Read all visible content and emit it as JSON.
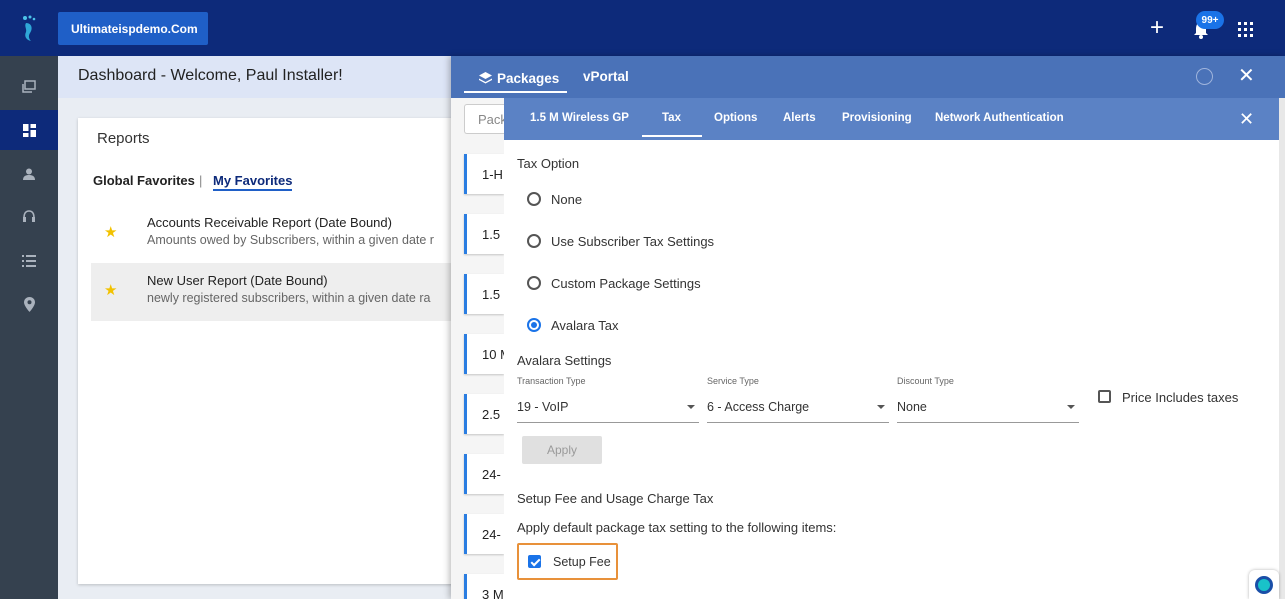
{
  "topbar": {
    "brand_label": "Ultimateispdemo.Com",
    "notification_badge": "99+",
    "icons": [
      "footprint-logo-icon",
      "plus-icon",
      "bell-icon",
      "apps-grid-icon"
    ]
  },
  "sidebar": {
    "items": [
      {
        "name": "sidebar-item-library",
        "icon": "library-icon",
        "active": false
      },
      {
        "name": "sidebar-item-dashboard",
        "icon": "dashboard-icon",
        "active": true
      },
      {
        "name": "sidebar-item-subscribers",
        "icon": "person-icon",
        "active": false
      },
      {
        "name": "sidebar-item-support",
        "icon": "headset-icon",
        "active": false
      },
      {
        "name": "sidebar-item-list",
        "icon": "list-icon",
        "active": false
      },
      {
        "name": "sidebar-item-map",
        "icon": "location-pin-icon",
        "active": false
      }
    ]
  },
  "dashboard": {
    "title": "Dashboard - Welcome, Paul Installer!",
    "reports_title": "Reports",
    "tabs": {
      "global": "Global Favorites",
      "separator": "|",
      "mine": "My Favorites"
    },
    "reports": [
      {
        "name": "Accounts Receivable Report (Date Bound)",
        "desc": "Amounts owed by Subscribers, within a given date r"
      },
      {
        "name": "New User Report (Date Bound)",
        "desc": "newly registered subscribers, within a given date ra"
      }
    ]
  },
  "packages_panel": {
    "tabs": [
      {
        "label": "Packages",
        "active": true
      },
      {
        "label": "vPortal",
        "active": false
      }
    ],
    "search_placeholder": "Pack",
    "cards": [
      "1-H",
      "1.5",
      "1.5",
      "10 M",
      "2.5",
      "24-",
      "24-",
      "3 M"
    ]
  },
  "detail_panel": {
    "tabs": [
      {
        "label": "1.5 M Wireless GP",
        "active": false
      },
      {
        "label": "Tax",
        "active": true
      },
      {
        "label": "Options",
        "active": false
      },
      {
        "label": "Alerts",
        "active": false
      },
      {
        "label": "Provisioning",
        "active": false
      },
      {
        "label": "Network Authentication",
        "active": false
      }
    ],
    "tax_option_title": "Tax Option",
    "tax_options": [
      {
        "label": "None",
        "selected": false
      },
      {
        "label": "Use Subscriber Tax Settings",
        "selected": false
      },
      {
        "label": "Custom Package Settings",
        "selected": false
      },
      {
        "label": "Avalara Tax",
        "selected": true
      }
    ],
    "avalara_title": "Avalara Settings",
    "transaction_type": {
      "label": "Transaction Type",
      "value": "19 - VoIP"
    },
    "service_type": {
      "label": "Service Type",
      "value": "6 - Access Charge"
    },
    "discount_type": {
      "label": "Discount Type",
      "value": "None"
    },
    "price_includes_taxes": {
      "label": "Price Includes taxes",
      "checked": false
    },
    "apply_label": "Apply",
    "setup_fee_title": "Setup Fee and Usage Charge Tax",
    "setup_fee_desc": "Apply default package tax setting to the following items:",
    "setup_fee_checkbox": {
      "label": "Setup Fee",
      "checked": true
    }
  },
  "colors": {
    "topbar": "#0d2a7a",
    "sidebar": "#35414f",
    "packages_header": "#4a72b8",
    "detail_header": "#5b82c5",
    "accent": "#1a73e8",
    "highlight_border": "#e8913a",
    "star": "#f2c200"
  }
}
